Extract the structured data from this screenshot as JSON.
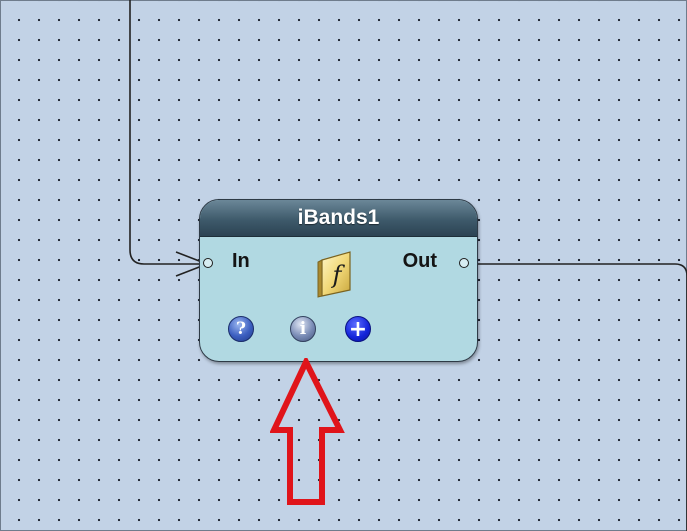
{
  "node": {
    "title": "iBands1",
    "input_label": "In",
    "output_label": "Out",
    "function_icon": "function-f-icon",
    "buttons": {
      "help": {
        "icon": "help-icon",
        "glyph": "?"
      },
      "info": {
        "icon": "info-icon",
        "glyph": "i"
      },
      "add": {
        "icon": "add-icon",
        "glyph": "+"
      }
    }
  },
  "annotation": {
    "icon": "red-up-arrow-icon",
    "color": "#e0141a"
  },
  "colors": {
    "canvas": "#c2d2e6",
    "node_body": "#b1d9e2",
    "node_header": "#3e5a6b",
    "wire": "#222222"
  }
}
